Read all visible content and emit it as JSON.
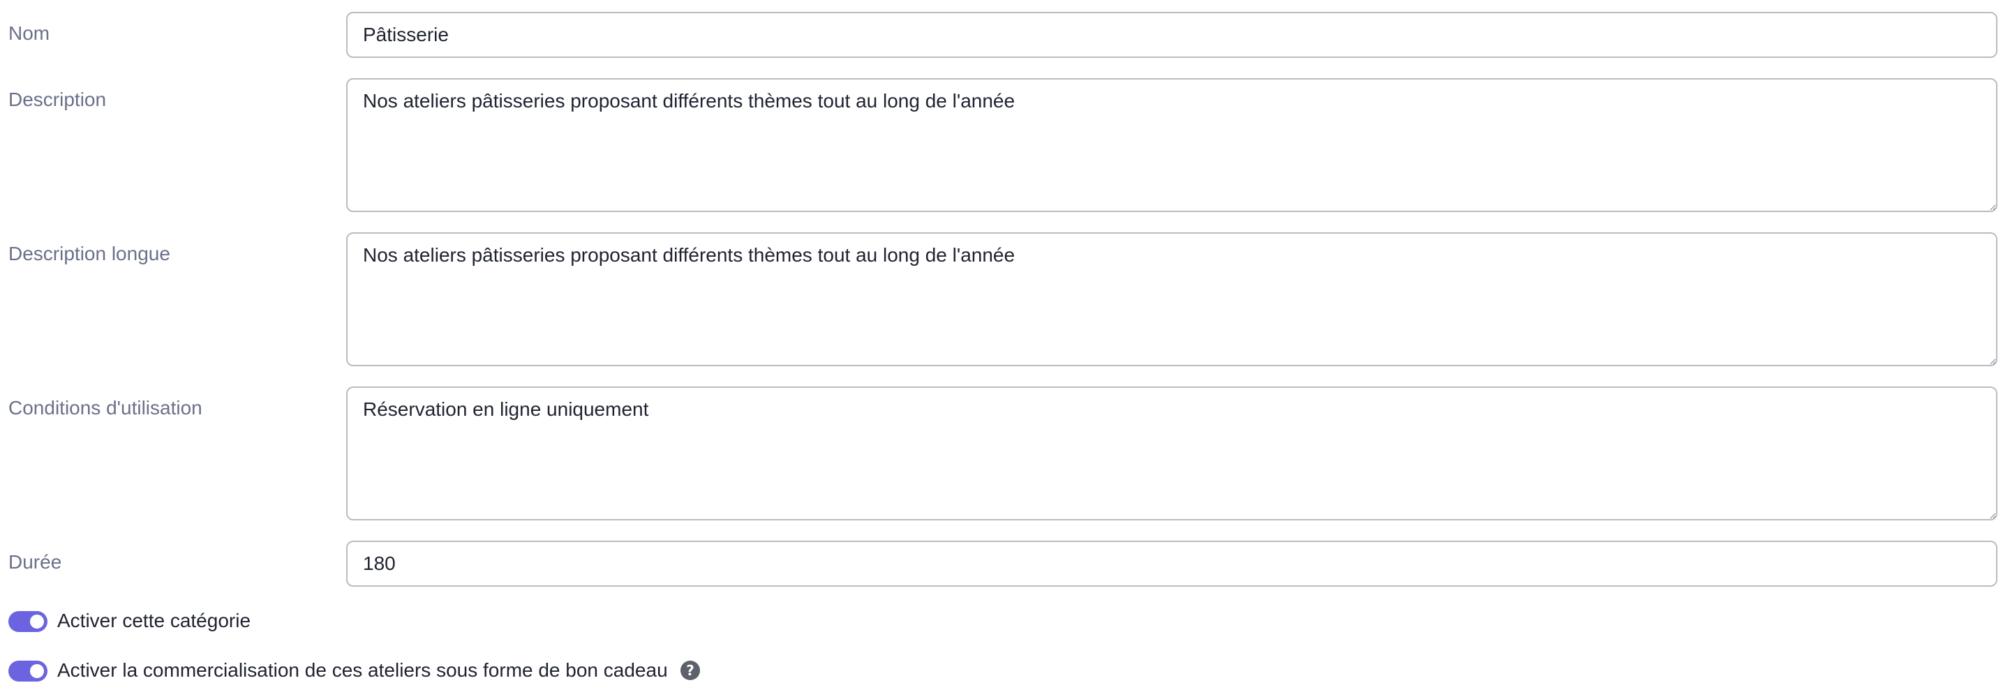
{
  "form": {
    "nom": {
      "label": "Nom",
      "value": "Pâtisserie"
    },
    "description": {
      "label": "Description",
      "value": "Nos ateliers pâtisseries proposant différents thèmes tout au long de l'année"
    },
    "description_longue": {
      "label": "Description longue",
      "value": "Nos ateliers pâtisseries proposant différents thèmes tout au long de l'année"
    },
    "conditions": {
      "label": "Conditions d'utilisation",
      "value": "Réservation en ligne uniquement"
    },
    "duree": {
      "label": "Durée",
      "value": "180"
    },
    "toggle_categorie": {
      "label": "Activer cette catégorie",
      "checked": true
    },
    "toggle_bon_cadeau": {
      "label": "Activer la commercialisation de ces ateliers sous forme de bon cadeau",
      "checked": true,
      "help_icon": "question-circle-icon",
      "help_glyph": "?"
    }
  },
  "colors": {
    "accent": "#6c63e0",
    "label": "#6b7089",
    "border": "#b9bcc4"
  }
}
